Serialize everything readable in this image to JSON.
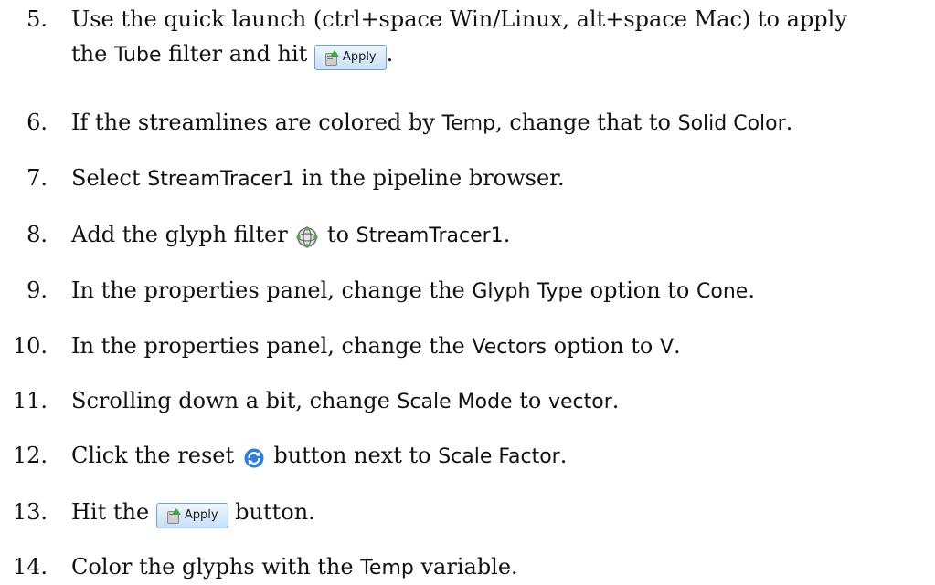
{
  "steps": [
    {
      "number": "5.",
      "line1": [
        "Use the quick launch (ctrl+space Win/Linux, alt+space Mac) to apply"
      ],
      "line2_prefix": "the ",
      "kw1": "Tube",
      "mid": " filter and hit ",
      "button": "Apply",
      "suffix": "."
    },
    {
      "number": "6.",
      "t1": "If the streamlines are colored by ",
      "k1": "Temp",
      "t2": ", change that to ",
      "k2": "Solid Color",
      "t3": "."
    },
    {
      "number": "7.",
      "t1": "Select ",
      "k1": "StreamTracer1",
      "t2": " in the pipeline browser."
    },
    {
      "number": "8.",
      "t1": "Add the glyph filter ",
      "icon": "glyph-filter-icon",
      "t2": " to ",
      "k1": "StreamTracer1",
      "t3": "."
    },
    {
      "number": "9.",
      "t1": "In the properties panel, change the ",
      "k1": "Glyph Type",
      "t2": " option to ",
      "k2": "Cone",
      "t3": "."
    },
    {
      "number": "10.",
      "t1": "In the properties panel, change the ",
      "k1": "Vectors",
      "t2": " option to ",
      "k2": "V",
      "t3": "."
    },
    {
      "number": "11.",
      "t1": "Scrolling down a bit, change ",
      "k1": "Scale Mode",
      "t2": " to ",
      "k2": "vector",
      "t3": "."
    },
    {
      "number": "12.",
      "t1": "Click the reset ",
      "icon": "reset-icon",
      "t2": " button next to ",
      "k1": "Scale Factor",
      "t3": "."
    },
    {
      "number": "13.",
      "t1": "Hit the ",
      "button": "Apply",
      "t2": " button."
    },
    {
      "number": "14.",
      "t1": "Color the glyphs with the ",
      "k1": "Temp",
      "t2": " variable."
    }
  ],
  "colors": {
    "apply_border": "#6aa5d8",
    "apply_fill": "#c7e0f6",
    "reset_blue": "#2f7fd6",
    "glyph_green": "#5aa84a"
  }
}
